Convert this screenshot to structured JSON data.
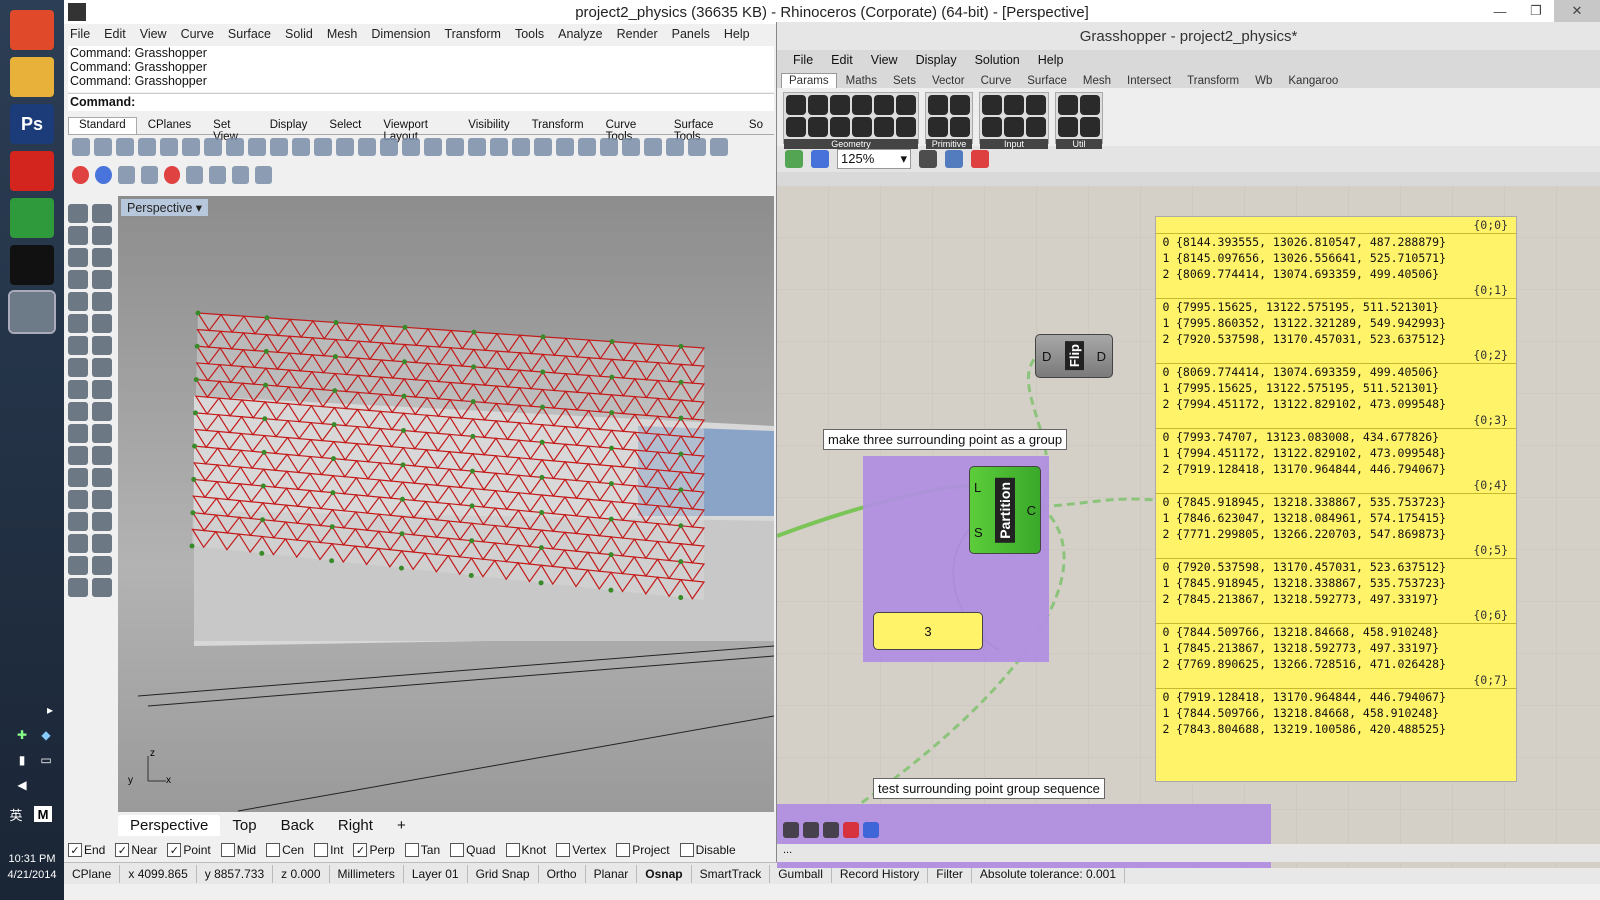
{
  "taskbar": {
    "apps": [
      {
        "icon": "windows-logo-icon",
        "label": "",
        "color": "#e04a2a"
      },
      {
        "icon": "file-explorer-icon",
        "label": "",
        "color": "#e8b23a"
      },
      {
        "icon": "photoshop-icon",
        "label": "Ps",
        "color": "#1b3c78"
      },
      {
        "icon": "sketchup-icon",
        "label": "",
        "color": "#d3251e"
      },
      {
        "icon": "chrome-icon",
        "label": "",
        "color": "#2f9a3c"
      },
      {
        "icon": "qq-icon",
        "label": "",
        "color": "#111111"
      },
      {
        "icon": "rhino-icon",
        "label": "",
        "color": "#6d7b88"
      }
    ],
    "ime": "英",
    "ime_mode": "M",
    "time": "10:31 PM",
    "date": "4/21/2014"
  },
  "rhino": {
    "title": "project2_physics (36635 KB) - Rhinoceros (Corporate) (64-bit) - [Perspective]",
    "menu": [
      "File",
      "Edit",
      "View",
      "Curve",
      "Surface",
      "Solid",
      "Mesh",
      "Dimension",
      "Transform",
      "Tools",
      "Analyze",
      "Render",
      "Panels",
      "Help"
    ],
    "command_history": [
      "Command: Grasshopper",
      "Command: Grasshopper",
      "Command: Grasshopper"
    ],
    "command_prompt": "Command:",
    "toolbar_tabs": [
      "Standard",
      "CPlanes",
      "Set View",
      "Display",
      "Select",
      "Viewport Layout",
      "Visibility",
      "Transform",
      "Curve Tools",
      "Surface Tools",
      "So"
    ],
    "viewport_label": "Perspective",
    "viewport_tabs": [
      "Perspective",
      "Top",
      "Back",
      "Right",
      "+"
    ],
    "osnaps": [
      {
        "label": "End",
        "checked": true
      },
      {
        "label": "Near",
        "checked": true
      },
      {
        "label": "Point",
        "checked": true
      },
      {
        "label": "Mid",
        "checked": false
      },
      {
        "label": "Cen",
        "checked": false
      },
      {
        "label": "Int",
        "checked": false
      },
      {
        "label": "Perp",
        "checked": true
      },
      {
        "label": "Tan",
        "checked": false
      },
      {
        "label": "Quad",
        "checked": false
      },
      {
        "label": "Knot",
        "checked": false
      },
      {
        "label": "Vertex",
        "checked": false
      },
      {
        "label": "Project",
        "checked": false
      },
      {
        "label": "Disable",
        "checked": false
      }
    ],
    "status": [
      "CPlane",
      "x 4099.865",
      "y 8857.733",
      "z 0.000",
      "Millimeters",
      "Layer 01",
      "Grid Snap",
      "Ortho",
      "Planar",
      "Osnap",
      "SmartTrack",
      "Gumball",
      "Record History",
      "Filter",
      "Absolute tolerance: 0.001"
    ],
    "axis_labels": {
      "x": "x",
      "y": "y",
      "z": "z"
    }
  },
  "grasshopper": {
    "title": "Grasshopper - project2_physics*",
    "menu": [
      "File",
      "Edit",
      "View",
      "Display",
      "Solution",
      "Help"
    ],
    "tabs": [
      "Params",
      "Maths",
      "Sets",
      "Vector",
      "Curve",
      "Surface",
      "Mesh",
      "Intersect",
      "Transform",
      "Wb",
      "Kangaroo"
    ],
    "ribbon_groups": [
      "Geometry",
      "Primitive",
      "Input",
      "Util"
    ],
    "zoom": "125%",
    "note1": "make three surrounding point as a group",
    "note2": "test surrounding point group sequence",
    "flip": {
      "name": "Flip",
      "in": "D",
      "out": "D"
    },
    "partition": {
      "name": "Partition",
      "in1": "L",
      "in2": "S",
      "out": "C"
    },
    "slider_value": "3",
    "panel": [
      {
        "branch": "{0;0}",
        "rows": [
          "{8144.393555, 13026.810547, 487.288879}",
          "{8145.097656, 13026.556641, 525.710571}",
          "{8069.774414, 13074.693359, 499.40506}"
        ]
      },
      {
        "branch": "{0;1}",
        "rows": [
          "{7995.15625, 13122.575195, 511.521301}",
          "{7995.860352, 13122.321289, 549.942993}",
          "{7920.537598, 13170.457031, 523.637512}"
        ]
      },
      {
        "branch": "{0;2}",
        "rows": [
          "{8069.774414, 13074.693359, 499.40506}",
          "{7995.15625, 13122.575195, 511.521301}",
          "{7994.451172, 13122.829102, 473.099548}"
        ]
      },
      {
        "branch": "{0;3}",
        "rows": [
          "{7993.74707, 13123.083008, 434.677826}",
          "{7994.451172, 13122.829102, 473.099548}",
          "{7919.128418, 13170.964844, 446.794067}"
        ]
      },
      {
        "branch": "{0;4}",
        "rows": [
          "{7845.918945, 13218.338867, 535.753723}",
          "{7846.623047, 13218.084961, 574.175415}",
          "{7771.299805, 13266.220703, 547.869873}"
        ]
      },
      {
        "branch": "{0;5}",
        "rows": [
          "{7920.537598, 13170.457031, 523.637512}",
          "{7845.918945, 13218.338867, 535.753723}",
          "{7845.213867, 13218.592773, 497.33197}"
        ]
      },
      {
        "branch": "{0;6}",
        "rows": [
          "{7844.509766, 13218.84668, 458.910248}",
          "{7845.213867, 13218.592773, 497.33197}",
          "{7769.890625, 13266.728516, 471.026428}"
        ]
      },
      {
        "branch": "{0;7}",
        "rows": [
          "{7919.128418, 13170.964844, 446.794067}",
          "{7844.509766, 13218.84668, 458.910248}",
          "{7843.804688, 13219.100586, 420.488525}"
        ]
      }
    ],
    "bottom_status": "..."
  }
}
